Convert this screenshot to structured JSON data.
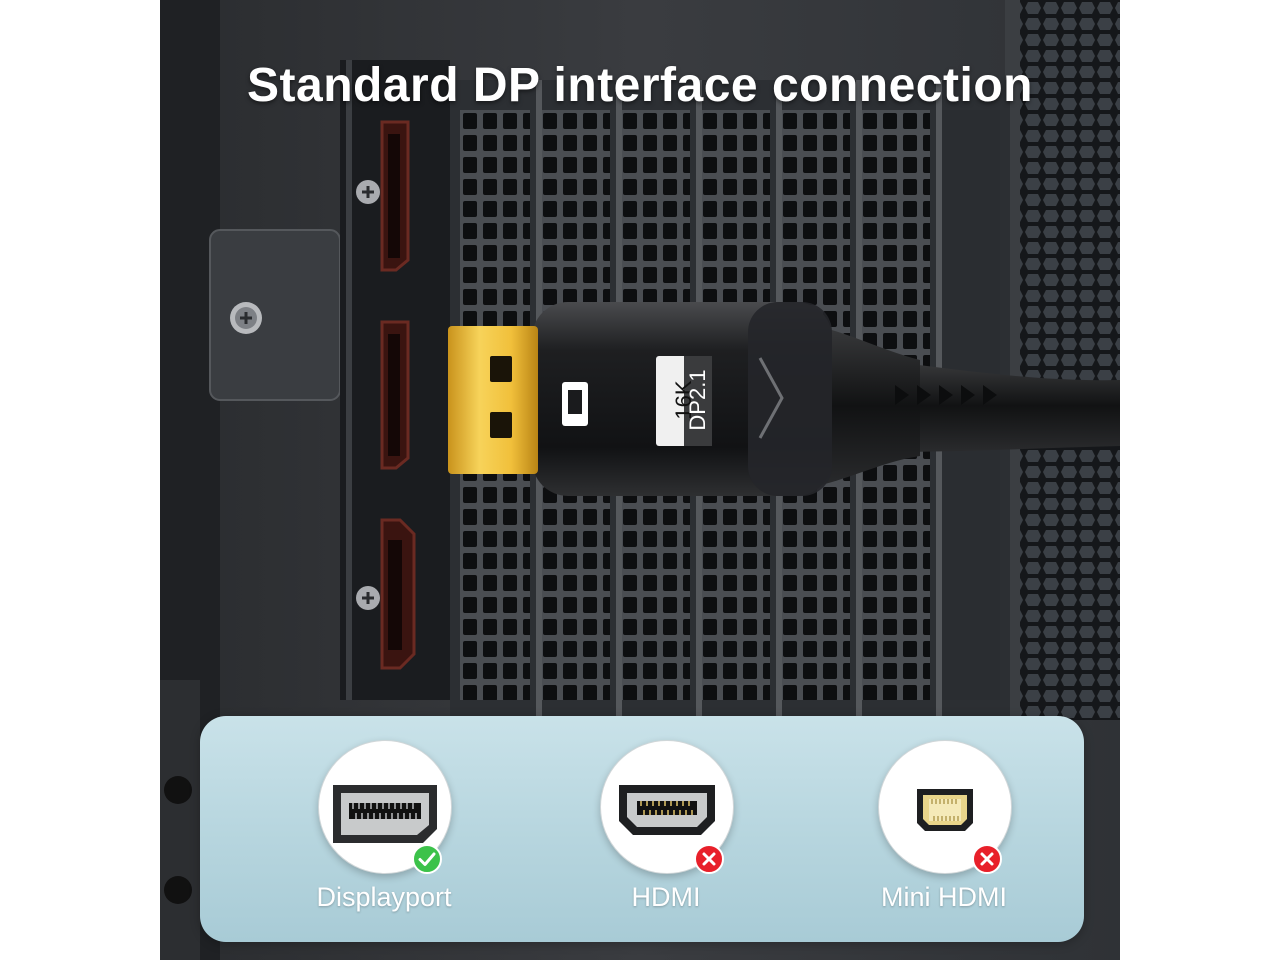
{
  "headline": "Standard DP interface connection",
  "connector": {
    "size_label": "16K",
    "version_label": "DP2.1",
    "logo": "displayport-logo"
  },
  "ports": [
    {
      "label": "Displayport",
      "icon": "displayport-port-icon",
      "compatible": true,
      "status_icon": "check-icon",
      "status_color": "#3cc24a"
    },
    {
      "label": "HDMI",
      "icon": "hdmi-port-icon",
      "compatible": false,
      "status_icon": "cross-icon",
      "status_color": "#e8202a"
    },
    {
      "label": "Mini HDMI",
      "icon": "mini-hdmi-port-icon",
      "compatible": false,
      "status_icon": "cross-icon",
      "status_color": "#e8202a"
    }
  ],
  "colors": {
    "panel": "#b6d5de",
    "gold_contact": "#f2c23a",
    "cable": "#1c1c1e"
  }
}
